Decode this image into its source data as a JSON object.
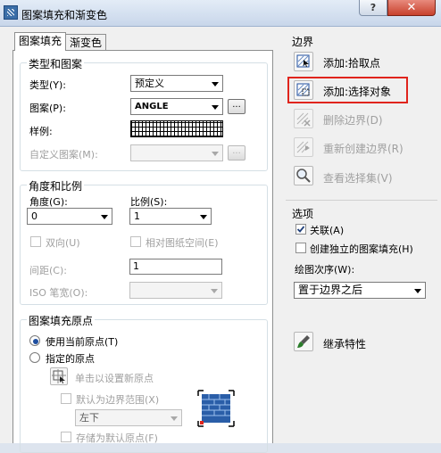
{
  "window": {
    "title": "图案填充和渐变色",
    "help": "?",
    "close": "✕"
  },
  "tabs": [
    "图案填充",
    "渐变色"
  ],
  "type_pattern": {
    "group_label": "类型和图案",
    "type_label": "类型(Y):",
    "type_value": "预定义",
    "pattern_label": "图案(P):",
    "pattern_value": "ANGLE",
    "ellipsis": "...",
    "sample_label": "样例:",
    "custom_label": "自定义图案(M):"
  },
  "angle_scale": {
    "group_label": "角度和比例",
    "angle_label": "角度(G):",
    "angle_value": "0",
    "scale_label": "比例(S):",
    "scale_value": "1",
    "double_label": "双向(U)",
    "relative_label": "相对图纸空间(E)",
    "spacing_label": "间距(C):",
    "spacing_value": "1",
    "iso_label": "ISO 笔宽(O):"
  },
  "origin": {
    "group_label": "图案填充原点",
    "use_current": "使用当前原点(T)",
    "specified": "指定的原点",
    "click_set": "单击以设置新原点",
    "default_extent": "默认为边界范围(X)",
    "position_value": "左下",
    "store_default": "存储为默认原点(F)"
  },
  "boundary": {
    "section_label": "边界",
    "add_pick": "添加:拾取点",
    "add_select": "添加:选择对象",
    "remove": "删除边界(D)",
    "recreate": "重新创建边界(R)",
    "view": "查看选择集(V)"
  },
  "options": {
    "section_label": "选项",
    "associative": "关联(A)",
    "create_separate": "创建独立的图案填充(H)",
    "draw_order_label": "绘图次序(W):",
    "draw_order_value": "置于边界之后"
  },
  "inherit": {
    "label": "继承特性"
  },
  "colors": {
    "highlight": "#e0241c",
    "accent": "#1f4fa0"
  }
}
